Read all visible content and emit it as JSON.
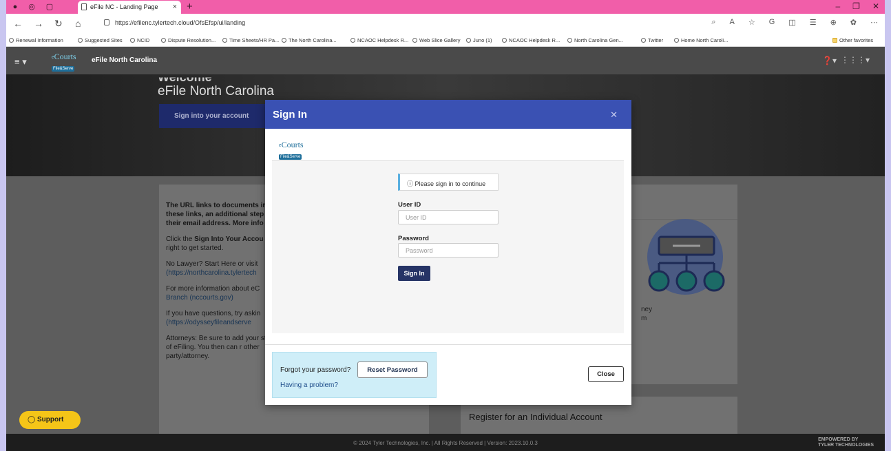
{
  "browser": {
    "tab_title": "eFile NC - Landing Page",
    "url": "https://efilenc.tylertech.cloud/OfsEfsp/ui/landing",
    "favorites": [
      "Renewal Information",
      "Suggested Sites",
      "NCID",
      "Dispute Resolution...",
      "Time Sheets/HR Pa...",
      "The North Carolina...",
      "NCAOC Helpdesk R...",
      "Web Slice Gallery",
      "Juno (1)",
      "NCAOC Helpdesk R...",
      "North Carolina Gen...",
      "Twitter",
      "Home North Caroli..."
    ],
    "other_favorites": "Other favorites"
  },
  "app": {
    "logo_top": "Courts",
    "logo_prefix": "e",
    "logo_bottom": "File&Serve",
    "title": "eFile North Carolina"
  },
  "hero": {
    "welcome": "Welcome",
    "title": "eFile North Carolina",
    "signin_button": "Sign into your account"
  },
  "left_card": {
    "p1": "The URL links to documents in these links, an additional step their email address. More info",
    "p2a": "Click the ",
    "p2b": "Sign Into Your Accou",
    "p2c": " right to get started.",
    "p3a": "No Lawyer? Start Here or visit",
    "p3b": "(https://northcarolina.tylertech",
    "p4a": "For more information about eC",
    "p4b": "Branch (nccourts.gov)",
    "p5a": "If you have questions, try askin",
    "p5b": "(https://odysseyfileandserve",
    "p6": "Attorneys: Be sure to add your step of eFiling. You then can r other party/attorney."
  },
  "right_card": {
    "text1": "ney",
    "text2": "m",
    "register": "Register for an Individual Account"
  },
  "footer": {
    "text": "© 2024 Tyler Technologies, Inc. | All Rights Reserved | Version: 2023.10.0.3",
    "tyler1": "EMPOWERED BY",
    "tyler2": "TYLER TECHNOLOGIES"
  },
  "support": {
    "label": "Support"
  },
  "modal": {
    "title": "Sign In",
    "notice": "Please sign in to continue",
    "userid_label": "User ID",
    "userid_placeholder": "User ID",
    "password_label": "Password",
    "password_placeholder": "Password",
    "signin_button": "Sign In",
    "forgot_text": "Forgot your password?",
    "reset_button": "Reset Password",
    "problem_link": "Having a problem?",
    "close_button": "Close"
  },
  "icons": {
    "brand_color": "#3a51b3",
    "support_color": "#f5c518",
    "tab_color": "#f15ea9"
  }
}
